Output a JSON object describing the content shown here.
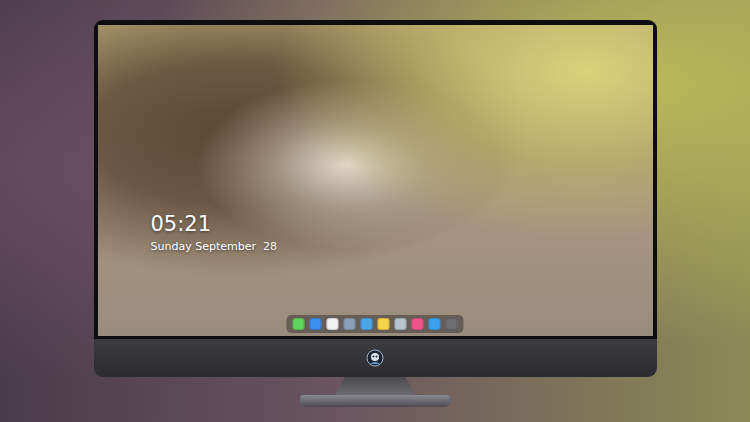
{
  "lock_screen": {
    "time": "05:21",
    "date": "Sunday September  28"
  },
  "dock": {
    "items": [
      {
        "color": "#5fd35a"
      },
      {
        "color": "#3e8ef0"
      },
      {
        "color": "#f2f2f2"
      },
      {
        "color": "#8aa0b8"
      },
      {
        "color": "#4aa6e8"
      },
      {
        "color": "#f5d547"
      },
      {
        "color": "#b9c4cc"
      },
      {
        "color": "#f0558a"
      },
      {
        "color": "#3aa0f0"
      },
      {
        "color": "#6d6d72"
      }
    ]
  }
}
